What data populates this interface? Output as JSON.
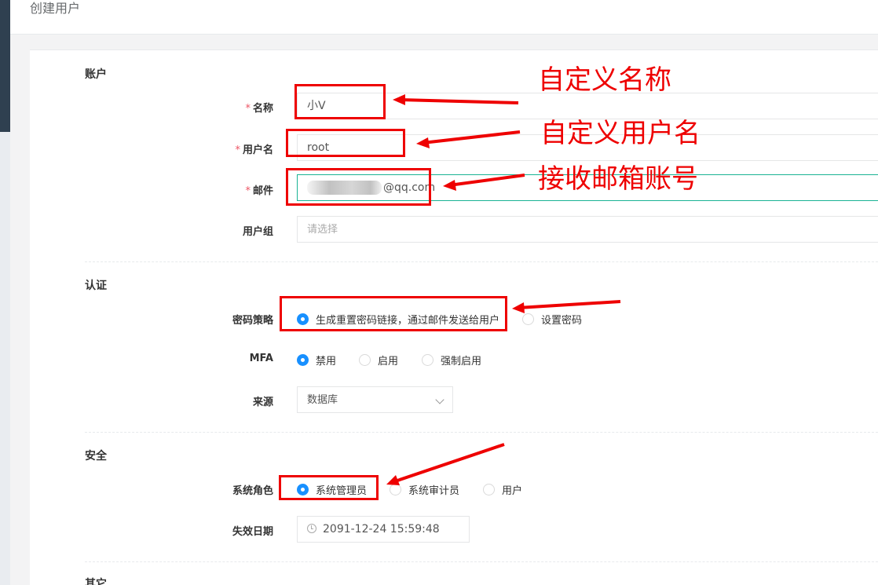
{
  "page": {
    "title": "创建用户"
  },
  "sections": {
    "account": "账户",
    "auth": "认证",
    "security": "安全",
    "other": "其它"
  },
  "account": {
    "name": {
      "label": "名称",
      "required_mark": "*",
      "value": "小V"
    },
    "username": {
      "label": "用户名",
      "required_mark": "*",
      "value": "root"
    },
    "email": {
      "label": "邮件",
      "required_mark": "*",
      "value": "@qq.com"
    },
    "group": {
      "label": "用户组",
      "placeholder": "请选择"
    }
  },
  "auth": {
    "password_strategy": {
      "label": "密码策略",
      "options": [
        "生成重置密码链接，通过邮件发送给用户",
        "设置密码"
      ],
      "selected": 0
    },
    "mfa": {
      "label": "MFA",
      "options": [
        "禁用",
        "启用",
        "强制启用"
      ],
      "selected": 0
    },
    "source": {
      "label": "来源",
      "value": "数据库"
    }
  },
  "security": {
    "system_role": {
      "label": "系统角色",
      "options": [
        "系统管理员",
        "系统审计员",
        "用户"
      ],
      "selected": 0
    },
    "expire_date": {
      "label": "失效日期",
      "value": "2091-12-24 15:59:48"
    }
  },
  "annotations": {
    "name": "自定义名称",
    "username": "自定义用户名",
    "email": "接收邮箱账号",
    "color": "#ee0000"
  },
  "colors": {
    "accent": "#1890ff",
    "focus_border": "#1ab394",
    "required": "#ed5565"
  },
  "icons": {
    "date": "clock-icon",
    "select": "chevron-down-icon"
  }
}
